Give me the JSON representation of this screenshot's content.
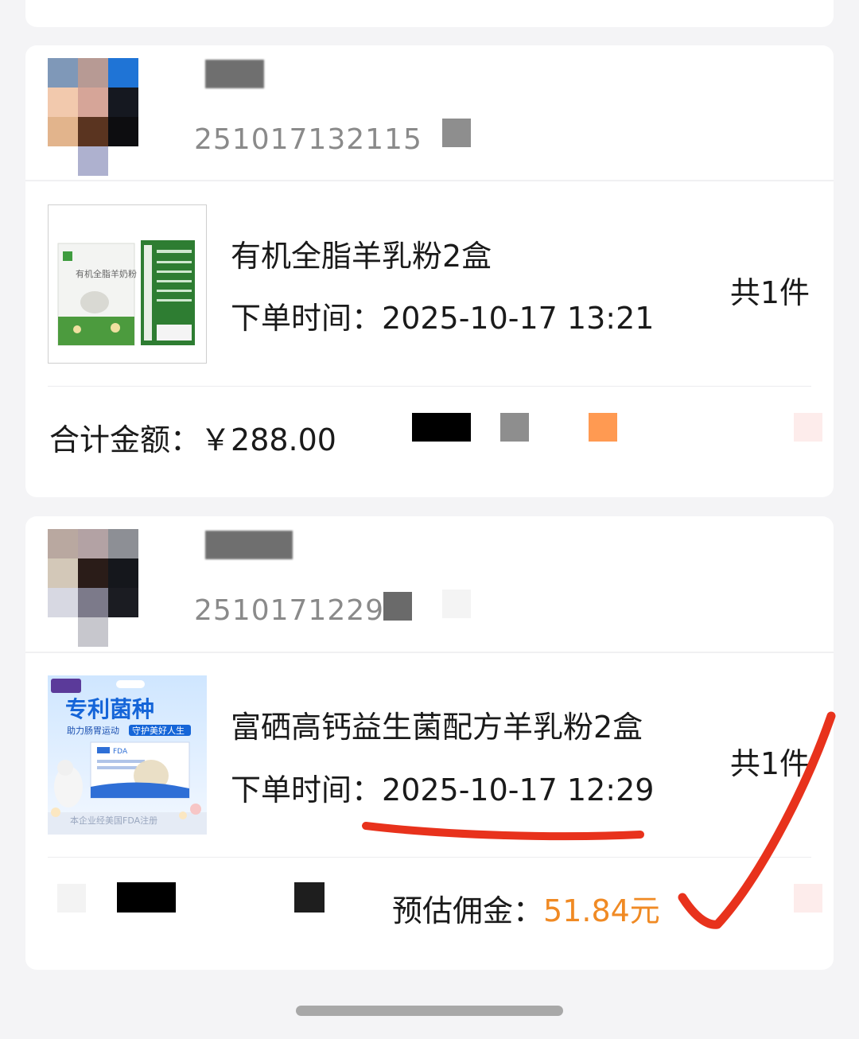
{
  "orders": [
    {
      "order_no": "251017132115",
      "product": {
        "name": "有机全脂羊乳粉2盒",
        "image_icon": "goat-milk-powder-product-image"
      },
      "time_label": "下单时间：",
      "time": "2025-10-17 13:21",
      "qty": "共1件",
      "total_label": "合计金额：",
      "total": "￥288.00"
    },
    {
      "order_no": "2510171229",
      "product": {
        "name": "富硒高钙益生菌配方羊乳粉2盒",
        "image_icon": "probiotic-goat-milk-powder-product-image",
        "image_text_1": "专利菌种",
        "image_text_2": "助力肠胃运动",
        "image_text_3": "守护美好人生",
        "image_text_4": "本企业经美国FDA注册",
        "image_text_5": "FDA"
      },
      "time_label": "下单时间：",
      "time": "2025-10-17 12:29",
      "qty": "共1件",
      "commission_label": "预估佣金：",
      "commission": "51.84元"
    }
  ],
  "annotations": {
    "underline_color": "#e8321c",
    "checkmark_color": "#e8321c"
  },
  "colors": {
    "commission_accent": "#f08a24",
    "background": "#f4f4f6",
    "card": "#ffffff"
  }
}
